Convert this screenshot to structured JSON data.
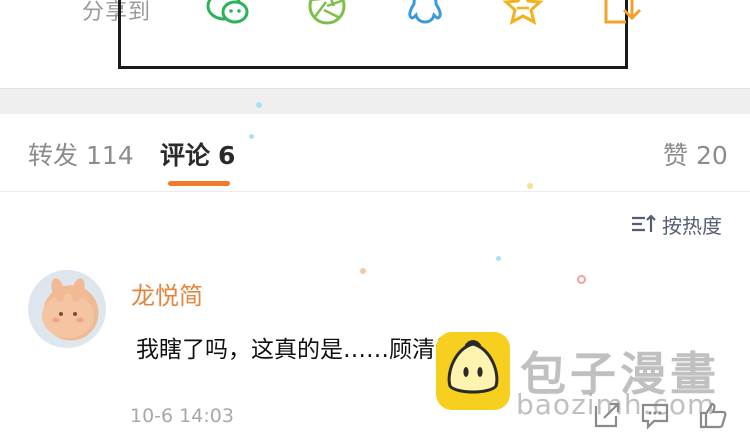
{
  "share": {
    "label": "分享到",
    "targets": [
      {
        "name": "wechat",
        "icon": "wechat-icon"
      },
      {
        "name": "moments",
        "icon": "moments-icon"
      },
      {
        "name": "qq",
        "icon": "qq-icon"
      },
      {
        "name": "favorite",
        "icon": "star-icon"
      },
      {
        "name": "save",
        "icon": "download-icon"
      }
    ]
  },
  "tabs": [
    {
      "label": "转发",
      "count": "114",
      "active": false
    },
    {
      "label": "评论",
      "count": "6",
      "active": true
    },
    {
      "label": "赞",
      "count": "20",
      "active": false
    }
  ],
  "sort": {
    "label": "按热度",
    "icon": "sort-icon"
  },
  "comment": {
    "author": "龙悦简",
    "text": "我瞎了吗，这真的是……顾清让？",
    "timestamp": "10-6 14:03",
    "actions": [
      "share-icon",
      "reply-icon",
      "like-icon"
    ]
  },
  "watermark": {
    "title": "包子漫畫",
    "url": "baozimh.com"
  },
  "colors": {
    "accent": "#f07b2b",
    "author": "#e2853d",
    "wechat": "#2bb25a",
    "star": "#f2b21d",
    "qq": "#3a9bd9"
  }
}
